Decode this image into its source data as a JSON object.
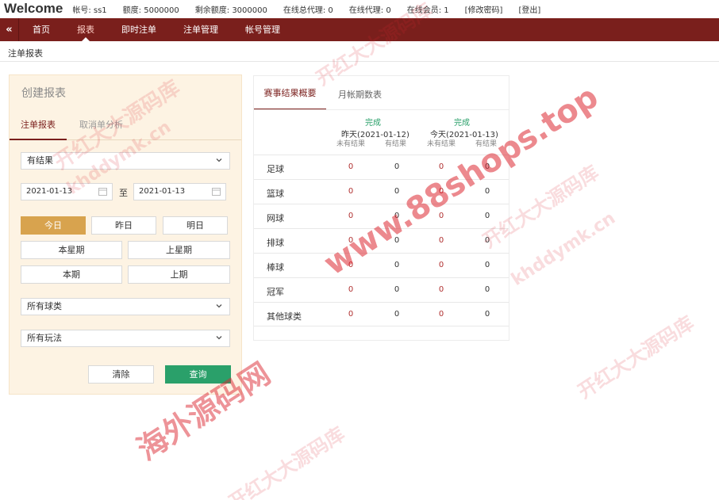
{
  "header": {
    "welcome": "Welcome",
    "account": "帐号: ss1",
    "credit": "额度: 5000000",
    "remaining": "剩余额度: 3000000",
    "online_agents_total": "在线总代理: 0",
    "online_agents": "在线代理: 0",
    "online_members": "在线会员: 1",
    "change_password": "[修改密码]",
    "logout": "[登出]"
  },
  "nav": {
    "collapse": "«",
    "items": [
      "首页",
      "报表",
      "即时注单",
      "注单管理",
      "帐号管理"
    ],
    "active_index": 1
  },
  "breadcrumb": "注单报表",
  "form": {
    "title": "创建报表",
    "tabs": [
      "注单报表",
      "取消单分析"
    ],
    "result_select": "有结果",
    "date_from": "2021-01-13",
    "date_to_label": "至",
    "date_to": "2021-01-13",
    "quick_dates": [
      "今日",
      "昨日",
      "明日",
      "本星期",
      "上星期",
      "本期",
      "上期"
    ],
    "sport_select": "所有球类",
    "play_select": "所有玩法",
    "clear_button": "清除",
    "query_button": "查询"
  },
  "summary": {
    "tabs": [
      "赛事结果概要",
      "月帐期数表"
    ],
    "days": [
      {
        "status": "完成",
        "label": "昨天(2021-01-12)",
        "cols": [
          "未有结果",
          "有结果"
        ]
      },
      {
        "status": "完成",
        "label": "今天(2021-01-13)",
        "cols": [
          "未有结果",
          "有结果"
        ]
      }
    ],
    "rows": [
      {
        "sport": "足球",
        "values": [
          "0",
          "0",
          "0",
          "0"
        ]
      },
      {
        "sport": "篮球",
        "values": [
          "0",
          "0",
          "0",
          "0"
        ]
      },
      {
        "sport": "网球",
        "values": [
          "0",
          "0",
          "0",
          "0"
        ]
      },
      {
        "sport": "排球",
        "values": [
          "0",
          "0",
          "0",
          "0"
        ]
      },
      {
        "sport": "棒球",
        "values": [
          "0",
          "0",
          "0",
          "0"
        ]
      },
      {
        "sport": "冠军",
        "values": [
          "0",
          "0",
          "0",
          "0"
        ]
      },
      {
        "sport": "其他球类",
        "values": [
          "0",
          "0",
          "0",
          "0"
        ]
      }
    ]
  },
  "watermarks": {
    "main": "www.88shops.top",
    "brand": "开红大大源码库",
    "domain": "khddymk.cn",
    "site": "海外源码网"
  },
  "colors": {
    "nav": "#7a1f1c",
    "today": "#d8a34e",
    "query": "#2aa06a",
    "panel": "#fdf3e3",
    "value_red": "#b03030"
  }
}
